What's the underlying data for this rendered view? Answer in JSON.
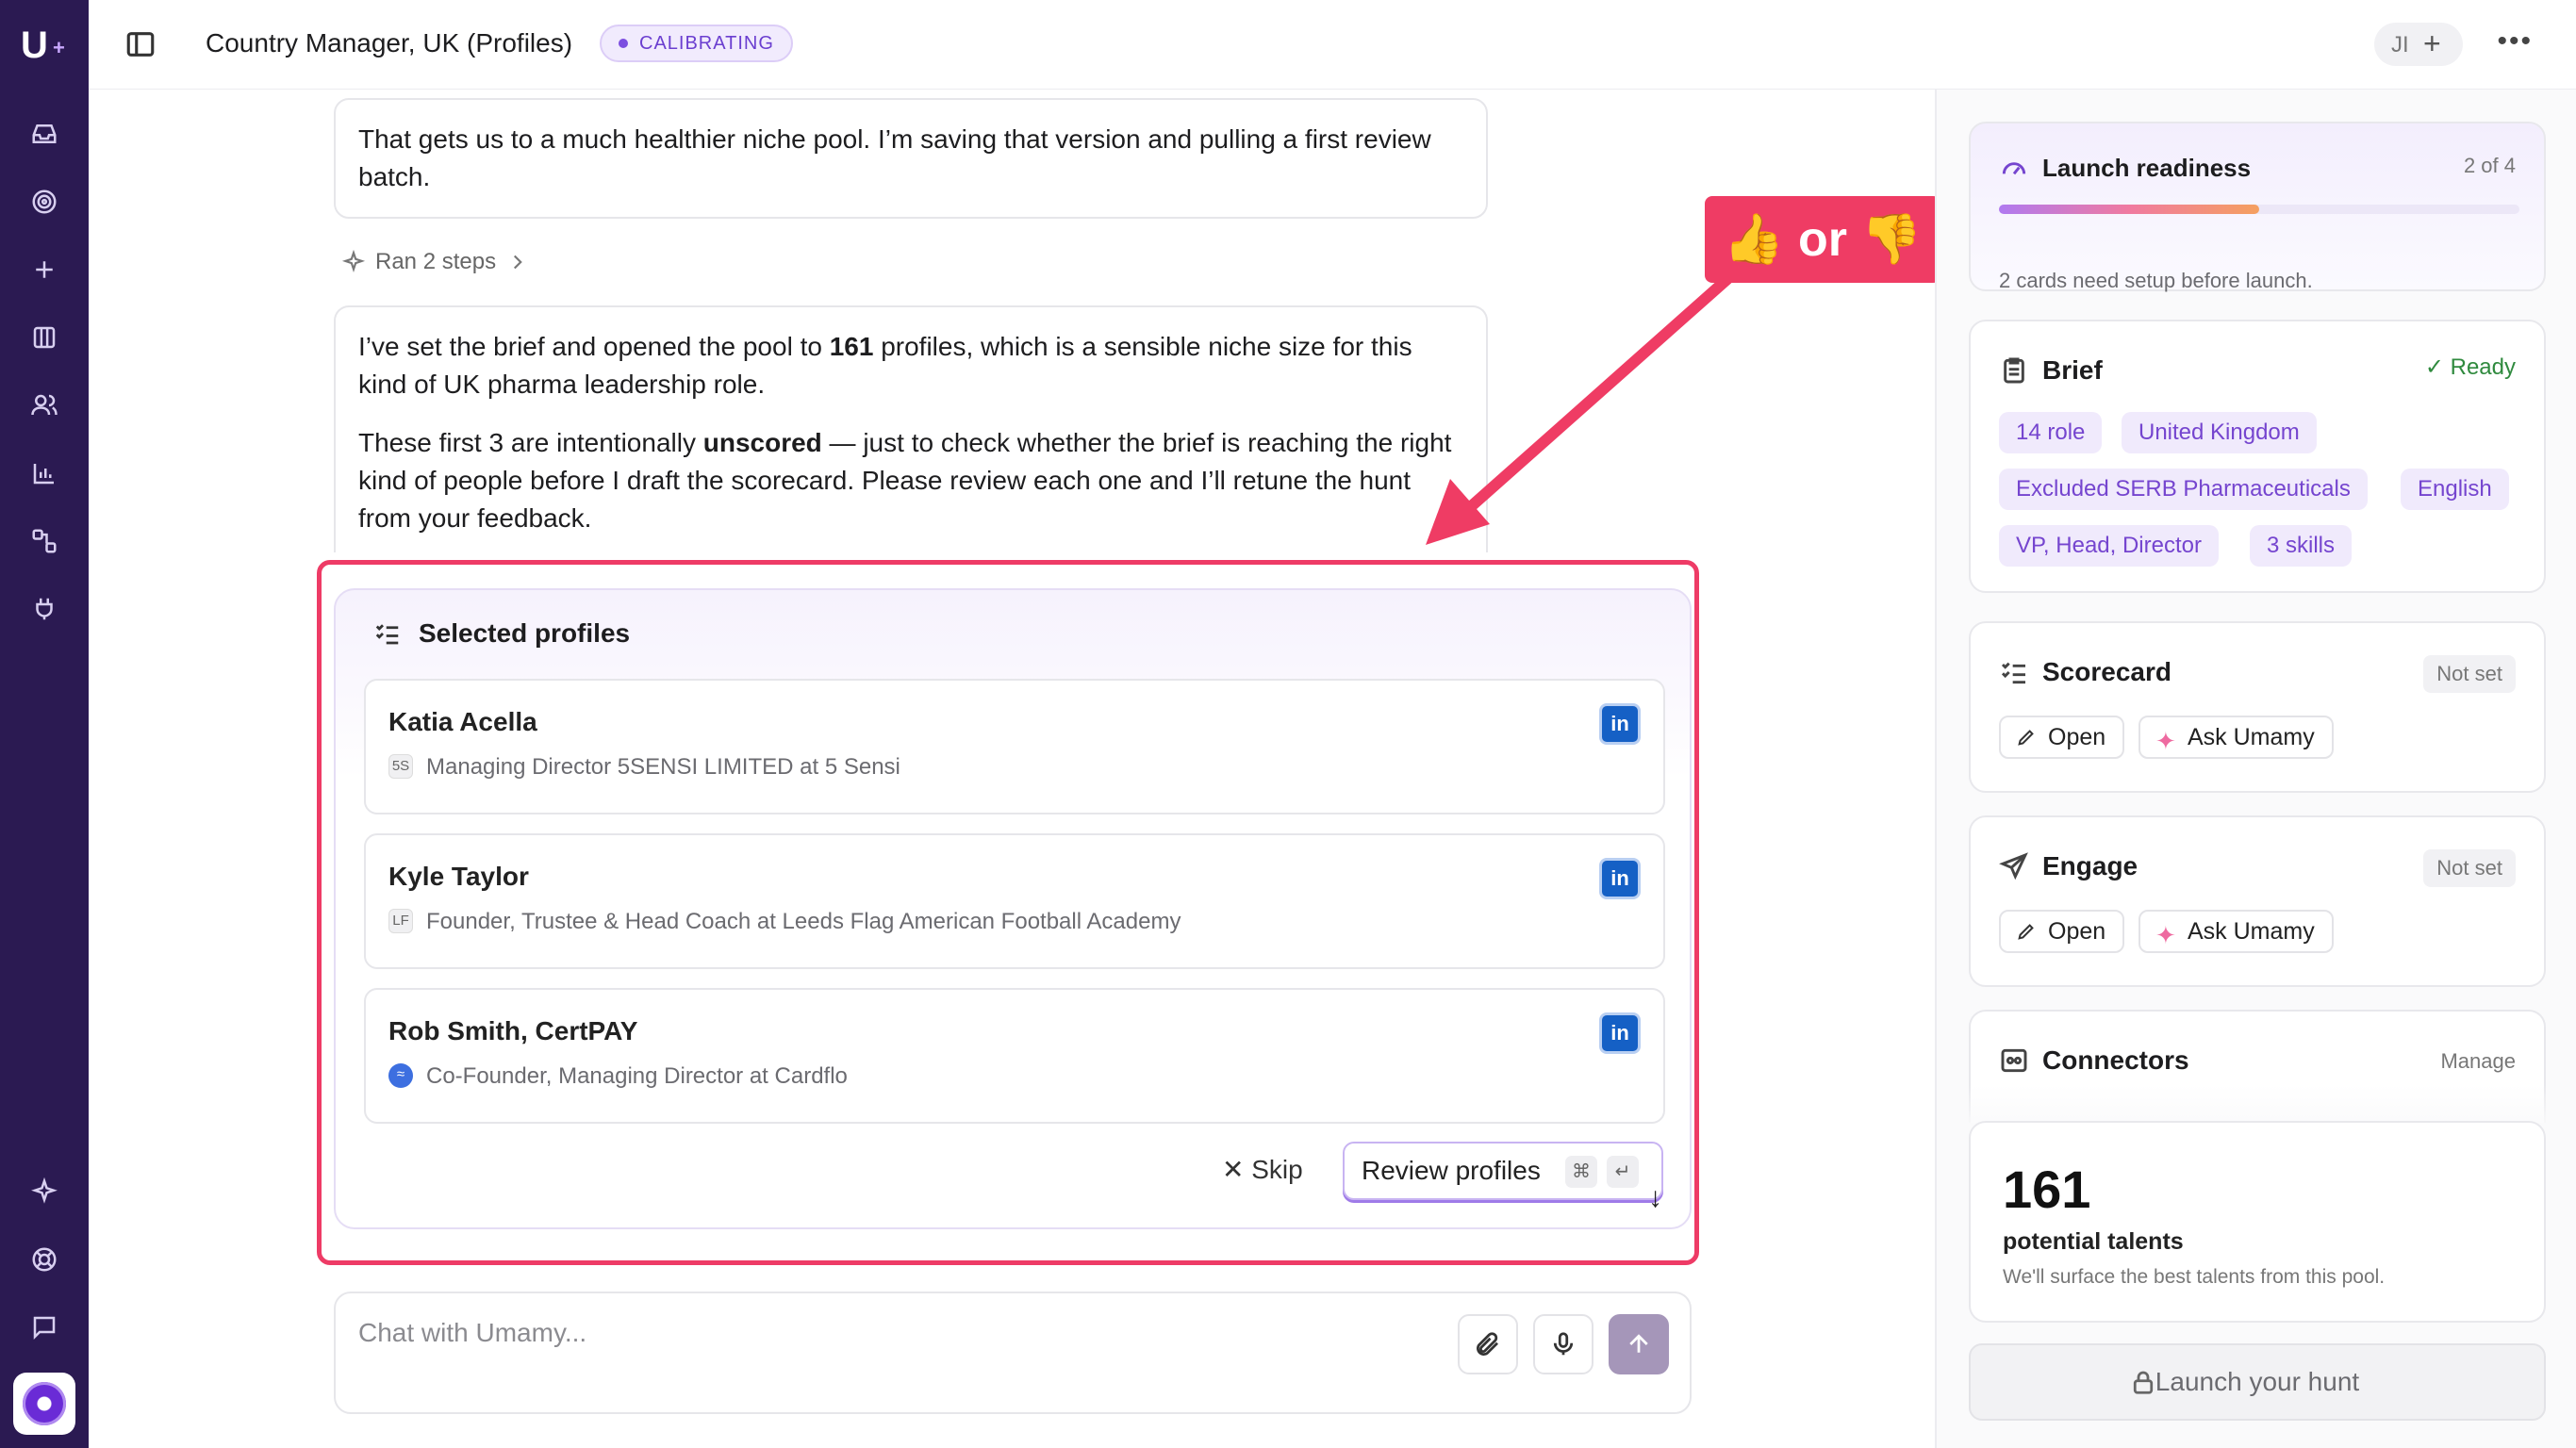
{
  "app": {
    "logo": "U",
    "logo_plus": "+"
  },
  "sidebar": {
    "icons": [
      "inbox-icon",
      "target-icon",
      "plus-icon",
      "columns-icon",
      "users-icon",
      "chart-icon",
      "workflow-icon",
      "plug-icon",
      "sparkle-icon",
      "help-icon",
      "chat-icon"
    ]
  },
  "header": {
    "title": "Country Manager, UK (Profiles)",
    "status_badge": "CALIBRATING",
    "user_initials": "JI",
    "add_label": "+"
  },
  "chat": {
    "message1": "That gets us to a much healthier niche pool. I’m saving that version and pulling a first review batch.",
    "ran_steps": "Ran 2 steps",
    "message2_p1_a": "I’ve set the brief and opened the pool to ",
    "message2_p1_b": "161",
    "message2_p1_c": " profiles, which is a sensible niche size for this kind of UK pharma leadership role.",
    "message2_p2_a": "These first 3 are intentionally ",
    "message2_p2_b": "unscored",
    "message2_p2_c": " — just to check whether the brief is reaching the right kind of people before I draft the scorecard. Please review each one and I’ll retune the hunt from your feedback."
  },
  "selected_profiles": {
    "title": "Selected profiles",
    "profiles": [
      {
        "name": "Katia Acella",
        "chip": "5S",
        "desc": "Managing Director 5SENSI LIMITED at 5 Sensi"
      },
      {
        "name": "Kyle Taylor",
        "chip": "LF",
        "desc": "Founder, Trustee & Head Coach at Leeds Flag American Football Academy"
      },
      {
        "name": "Rob Smith, CertPAY",
        "chip": "≈",
        "desc": "Co-Founder, Managing Director at Cardflo"
      }
    ],
    "linkedin_label": "in",
    "skip_label": "Skip",
    "review_label": "Review profiles",
    "kbd_cmd": "⌘",
    "kbd_enter": "↵"
  },
  "annotation": {
    "text": "👍 or 👎"
  },
  "chat_input": {
    "placeholder": "Chat with Umamy..."
  },
  "right_panel": {
    "launch_readiness": {
      "title": "Launch readiness",
      "count": "2 of 4",
      "progress": 0.5,
      "sub": "2 cards need setup before launch."
    },
    "brief": {
      "title": "Brief",
      "status": "✓ Ready",
      "tags": [
        "14 role",
        "United Kingdom",
        "Excluded SERB Pharmaceuticals",
        "English",
        "VP, Head, Director",
        "3 skills"
      ]
    },
    "scorecard": {
      "title": "Scorecard",
      "status": "Not set",
      "open_label": "Open",
      "ask_label": "Ask Umamy"
    },
    "engage": {
      "title": "Engage",
      "status": "Not set",
      "open_label": "Open",
      "ask_label": "Ask Umamy"
    },
    "connectors": {
      "title": "Connectors",
      "manage_label": "Manage"
    },
    "talents": {
      "count": "161",
      "label": "potential talents",
      "desc": "We'll surface the best talents from this pool."
    },
    "launch_label": "Launch your hunt"
  },
  "colors": {
    "rail": "#2b1a52",
    "accent": "#7545cf",
    "highlight": "#ee3b66",
    "ready": "#2f8a3e"
  }
}
